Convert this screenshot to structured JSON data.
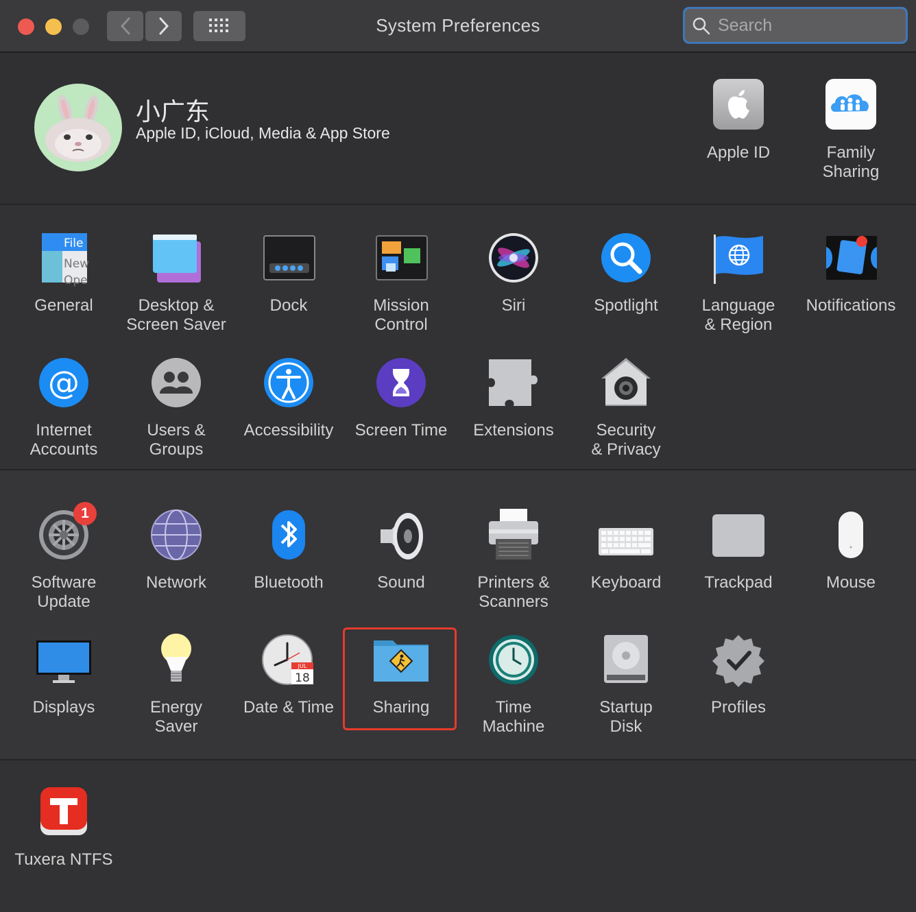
{
  "window": {
    "title": "System Preferences"
  },
  "search": {
    "placeholder": "Search"
  },
  "account": {
    "name": "小广东",
    "subtitle": "Apple ID, iCloud, Media & App Store",
    "panes": [
      {
        "label": "Apple ID",
        "icon": "apple-id-icon"
      },
      {
        "label": "Family\nSharing",
        "icon": "family-sharing-icon"
      }
    ]
  },
  "panes": {
    "general": "General",
    "desktop": "Desktop &\nScreen Saver",
    "dock": "Dock",
    "mission": "Mission\nControl",
    "siri": "Siri",
    "spotlight": "Spotlight",
    "language": "Language\n& Region",
    "notifications": "Notifications",
    "internet": "Internet\nAccounts",
    "users": "Users &\nGroups",
    "accessibility": "Accessibility",
    "screentime": "Screen Time",
    "extensions": "Extensions",
    "security": "Security\n& Privacy",
    "softwareupdate": "Software\nUpdate",
    "network": "Network",
    "bluetooth": "Bluetooth",
    "sound": "Sound",
    "printers": "Printers &\nScanners",
    "keyboard": "Keyboard",
    "trackpad": "Trackpad",
    "mouse": "Mouse",
    "displays": "Displays",
    "energy": "Energy\nSaver",
    "datetime": "Date & Time",
    "sharing": "Sharing",
    "timemachine": "Time\nMachine",
    "startup": "Startup\nDisk",
    "profiles": "Profiles",
    "tuxera": "Tuxera NTFS"
  },
  "badges": {
    "software_update": "1"
  },
  "general_icon_text": {
    "file": "File",
    "new": "New",
    "open": "Ope"
  },
  "datetime_icon": {
    "month": "JUL",
    "day": "18"
  },
  "colors": {
    "highlight": "#e53b2c",
    "search_focus": "#3f77b8"
  }
}
